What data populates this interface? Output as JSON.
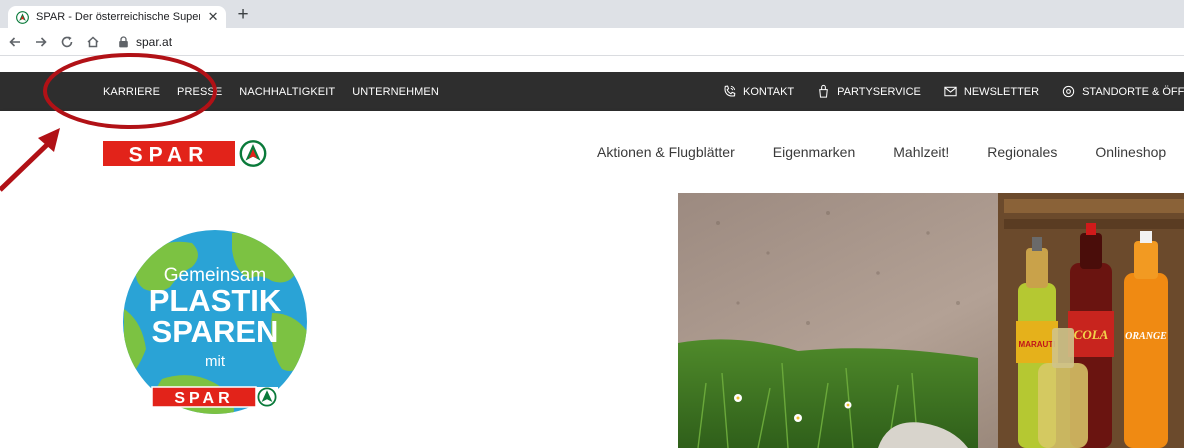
{
  "browser": {
    "tab_title": "SPAR - Der österreichische Super",
    "tab_close": "✕",
    "new_tab": "+",
    "url": "spar.at"
  },
  "topbar": {
    "left_links": [
      "KARRIERE",
      "PRESSE",
      "NACHHALTIGKEIT",
      "UNTERNEHMEN"
    ],
    "right_items": [
      {
        "label": "KONTAKT",
        "icon": "phone-icon"
      },
      {
        "label": "PARTYSERVICE",
        "icon": "party-bag-icon"
      },
      {
        "label": "NEWSLETTER",
        "icon": "mail-icon"
      },
      {
        "label": "STANDORTE & ÖFFN",
        "icon": "location-icon"
      }
    ]
  },
  "header": {
    "logo_text": "SPAR",
    "nav": [
      "Aktionen & Flugblätter",
      "Eigenmarken",
      "Mahlzeit!",
      "Regionales",
      "Onlineshop"
    ]
  },
  "campaign": {
    "line1": "Gemeinsam",
    "line2": "PLASTIK",
    "line3": "SPAREN",
    "line4": "mit",
    "logo_text": "SPAR"
  },
  "hero": {
    "bottle_labels": [
      "MARAUTI",
      "COLA",
      "ORANGE"
    ]
  },
  "colors": {
    "spar_red": "#e2231a",
    "spar_green": "#0a7a3a",
    "topbar_bg": "#2e2e2e",
    "annotation_red": "#b11116",
    "globe_blue": "#2aa3d6",
    "globe_green": "#7cc242"
  }
}
